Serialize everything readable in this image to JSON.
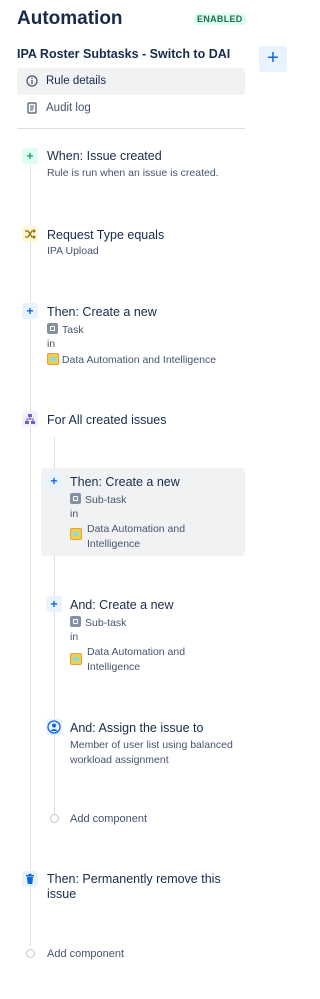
{
  "header": {
    "title": "Automation",
    "status_badge": "ENABLED",
    "rule_name": "IPA Roster Subtasks - Switch to DAI",
    "add_button": "+"
  },
  "menu": [
    {
      "label": "Rule details",
      "icon": "info-icon"
    },
    {
      "label": "Audit log",
      "icon": "document-icon"
    }
  ],
  "steps": {
    "trigger": {
      "title": "When: Issue created",
      "subtitle": "Rule is run when an issue is created.",
      "icon": "plus-icon"
    },
    "condition": {
      "title": "Request Type equals",
      "subtitle": "IPA Upload",
      "icon": "shuffle-icon"
    },
    "create_task": {
      "title": "Then: Create a new",
      "issue_type": "Task",
      "in_label": "in",
      "project": "Data Automation and Intelligence",
      "icon": "plus-icon"
    },
    "branch": {
      "title": "For All created issues",
      "icon": "branch-icon"
    },
    "subtask1": {
      "title": "Then: Create a new",
      "issue_type": "Sub-task",
      "in_label": "in",
      "project_line1": "Data Automation and",
      "project_line2": "Intelligence",
      "icon": "plus-icon"
    },
    "subtask2": {
      "title": "And: Create a new",
      "issue_type": "Sub-task",
      "in_label": "in",
      "project_line1": "Data Automation and",
      "project_line2": "Intelligence",
      "icon": "plus-icon"
    },
    "assign": {
      "title": "And: Assign the issue to",
      "subtitle_line1": "Member of user list using balanced",
      "subtitle_line2": "workload assignment",
      "icon": "user-icon"
    },
    "add_component_inner": "Add component",
    "remove": {
      "title_line1": "Then: Permanently remove this",
      "title_line2": "issue",
      "icon": "trash-icon"
    },
    "add_component_outer": "Add component"
  },
  "colors": {
    "trigger": "#22a06b",
    "condition": "#946f00",
    "action": "#0c66e4",
    "branch": "#6e5dc6",
    "enabled": "#216e4e"
  }
}
